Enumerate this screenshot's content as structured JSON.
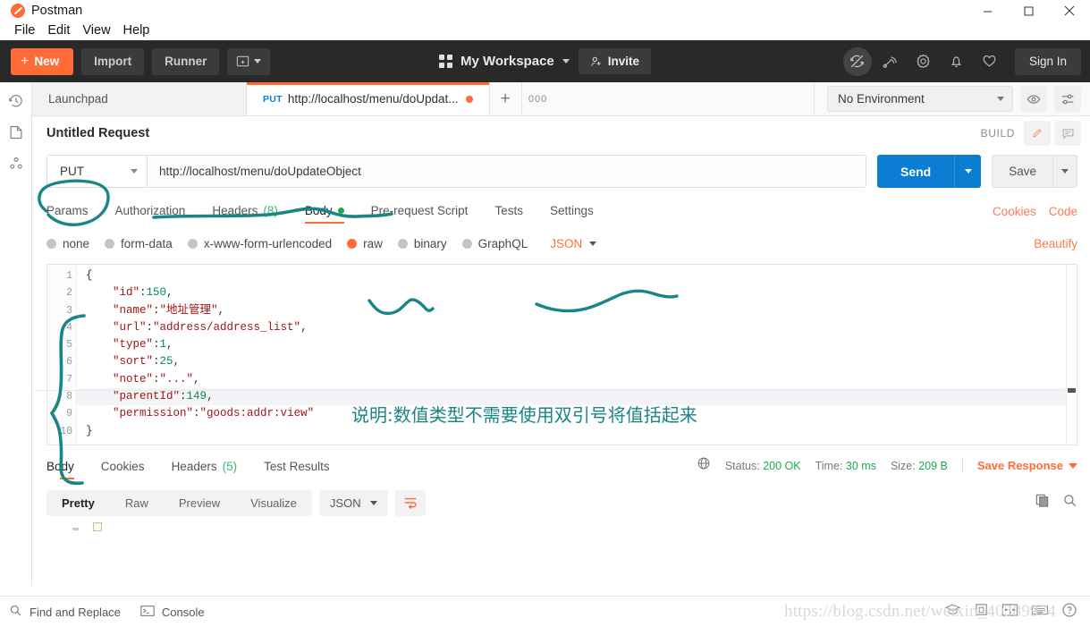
{
  "window": {
    "app_title": "Postman",
    "logo_icon": "postman-logo-icon",
    "minimize": "minimize-icon",
    "maximize": "maximize-icon",
    "close": "close-icon"
  },
  "menubar": {
    "items": [
      "File",
      "Edit",
      "View",
      "Help"
    ]
  },
  "header": {
    "new_label": "New",
    "new_plus": "+",
    "import_label": "Import",
    "runner_label": "Runner",
    "workspace_label": "My Workspace",
    "invite_label": "Invite",
    "signin_label": "Sign In",
    "icons": [
      "sync-off-icon",
      "broadcast-icon",
      "gear-icon",
      "bell-icon",
      "heart-icon"
    ]
  },
  "rail": {
    "icons": [
      "history-icon",
      "collections-icon",
      "apis-icon"
    ]
  },
  "tabs": {
    "items": [
      {
        "label": "Launchpad",
        "method": "",
        "active": false,
        "unsaved": false
      },
      {
        "label": "http://localhost/menu/doUpdat...",
        "method": "PUT",
        "active": true,
        "unsaved": true
      }
    ],
    "add_label": "+",
    "more_label": "000"
  },
  "environment": {
    "selected": "No Environment",
    "eye_icon": "eye-icon",
    "settings_icon": "sliders-icon"
  },
  "request": {
    "title": "Untitled Request",
    "build_label": "BUILD",
    "edit_icon": "pencil-icon",
    "comment_icon": "comment-icon",
    "method": "PUT",
    "url": "http://localhost/menu/doUpdateObject",
    "send_label": "Send",
    "save_label": "Save",
    "tabs": [
      {
        "label": "Params",
        "count": "",
        "active": false,
        "dot": false
      },
      {
        "label": "Authorization",
        "count": "",
        "active": false,
        "dot": false
      },
      {
        "label": "Headers",
        "count": "(8)",
        "active": false,
        "dot": false
      },
      {
        "label": "Body",
        "count": "",
        "active": true,
        "dot": true
      },
      {
        "label": "Pre-request Script",
        "count": "",
        "active": false,
        "dot": false
      },
      {
        "label": "Tests",
        "count": "",
        "active": false,
        "dot": false
      },
      {
        "label": "Settings",
        "count": "",
        "active": false,
        "dot": false
      }
    ],
    "links": [
      "Cookies",
      "Code"
    ],
    "body_types": [
      {
        "label": "none",
        "selected": false
      },
      {
        "label": "form-data",
        "selected": false
      },
      {
        "label": "x-www-form-urlencoded",
        "selected": false
      },
      {
        "label": "raw",
        "selected": true
      },
      {
        "label": "binary",
        "selected": false
      },
      {
        "label": "GraphQL",
        "selected": false
      }
    ],
    "raw_format": "JSON",
    "beautify_label": "Beautify"
  },
  "editor": {
    "line_numbers": [
      "1",
      "2",
      "3",
      "4",
      "5",
      "6",
      "7",
      "8",
      "9",
      "10"
    ],
    "lines": [
      {
        "n": 1,
        "segments": [
          {
            "t": "{",
            "c": "p"
          }
        ]
      },
      {
        "n": 2,
        "segments": [
          {
            "t": "    \"id\"",
            "c": "k"
          },
          {
            "t": ":",
            "c": "p"
          },
          {
            "t": "150",
            "c": "n"
          },
          {
            "t": ",",
            "c": "p"
          }
        ]
      },
      {
        "n": 3,
        "segments": [
          {
            "t": "    \"name\"",
            "c": "k"
          },
          {
            "t": ":",
            "c": "p"
          },
          {
            "t": "\"地址管理\"",
            "c": "s"
          },
          {
            "t": ",",
            "c": "p"
          }
        ]
      },
      {
        "n": 4,
        "segments": [
          {
            "t": "    \"url\"",
            "c": "k"
          },
          {
            "t": ":",
            "c": "p"
          },
          {
            "t": "\"address/address_list\"",
            "c": "s"
          },
          {
            "t": ",",
            "c": "p"
          }
        ]
      },
      {
        "n": 5,
        "segments": [
          {
            "t": "    \"type\"",
            "c": "k"
          },
          {
            "t": ":",
            "c": "p"
          },
          {
            "t": "1",
            "c": "n"
          },
          {
            "t": ",",
            "c": "p"
          }
        ]
      },
      {
        "n": 6,
        "segments": [
          {
            "t": "    \"sort\"",
            "c": "k"
          },
          {
            "t": ":",
            "c": "p"
          },
          {
            "t": "25",
            "c": "n"
          },
          {
            "t": ",",
            "c": "p"
          }
        ]
      },
      {
        "n": 7,
        "segments": [
          {
            "t": "    \"note\"",
            "c": "k"
          },
          {
            "t": ":",
            "c": "p"
          },
          {
            "t": "\"...\"",
            "c": "s"
          },
          {
            "t": ",",
            "c": "p"
          }
        ]
      },
      {
        "n": 8,
        "segments": [
          {
            "t": "    \"parentId\"",
            "c": "k"
          },
          {
            "t": ":",
            "c": "p"
          },
          {
            "t": "149",
            "c": "n"
          },
          {
            "t": ",",
            "c": "p"
          }
        ],
        "highlight": true
      },
      {
        "n": 9,
        "segments": [
          {
            "t": "    \"permission\"",
            "c": "k"
          },
          {
            "t": ":",
            "c": "p"
          },
          {
            "t": "\"goods:addr:view\"",
            "c": "s"
          }
        ]
      },
      {
        "n": 10,
        "segments": [
          {
            "t": "}",
            "c": "p"
          }
        ]
      }
    ]
  },
  "response": {
    "tabs": [
      {
        "label": "Body",
        "count": "",
        "active": true
      },
      {
        "label": "Cookies",
        "count": "",
        "active": false
      },
      {
        "label": "Headers",
        "count": "(5)",
        "active": false
      },
      {
        "label": "Test Results",
        "count": "",
        "active": false
      }
    ],
    "globe_icon": "globe-icon",
    "status_label": "Status:",
    "status_value": "200 OK",
    "time_label": "Time:",
    "time_value": "30 ms",
    "size_label": "Size:",
    "size_value": "209 B",
    "save_response_label": "Save Response",
    "view_modes": [
      "Pretty",
      "Raw",
      "Preview",
      "Visualize"
    ],
    "active_view": "Pretty",
    "format": "JSON",
    "wrap_icon": "wrap-lines-icon",
    "copy_icon": "copy-icon",
    "search_icon": "search-icon"
  },
  "footer": {
    "find_replace_label": "Find and Replace",
    "find_icon": "search-icon",
    "console_label": "Console",
    "console_icon": "terminal-icon",
    "right_icons": [
      "bootcamp-icon",
      "trash-icon",
      "two-pane-icon",
      "keyboard-icon",
      "help-icon"
    ],
    "bootcamp_label": "Bootcamp"
  },
  "annotations": {
    "note_text": "说明:数值类型不需要使用双引号将值括起来",
    "color": "#1a8585",
    "marks": [
      "circle-around-put",
      "underline-url",
      "underline-raw",
      "underline-json",
      "brace-around-json-body"
    ]
  },
  "watermark": {
    "text": "https://blog.csdn.net/weixin_40389974"
  }
}
